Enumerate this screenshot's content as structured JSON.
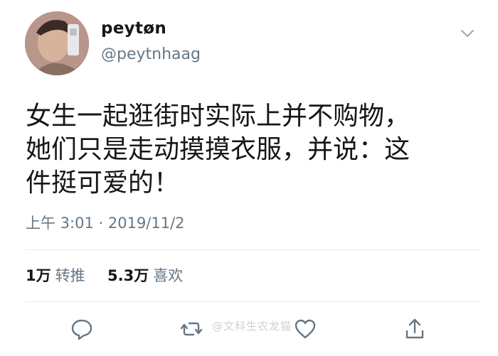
{
  "user": {
    "display_name": "peytøn",
    "handle": "@peytnhaag",
    "avatar_icon": "profile-photo"
  },
  "tweet": {
    "text": "女生一起逛街时实际上并不购物，\n她们只是走动摸摸衣服，并说：这\n件挺可爱的！",
    "timestamp": "上午 3:01 · 2019/11/2"
  },
  "stats": {
    "retweets_count": "1万",
    "retweets_label": "转推",
    "likes_count": "5.3万",
    "likes_label": "喜欢"
  },
  "actions": {
    "reply_icon": "reply-icon",
    "retweet_icon": "retweet-icon",
    "like_icon": "heart-icon",
    "share_icon": "share-icon"
  },
  "watermark": "@文科生农龙猫",
  "colors": {
    "text_primary": "#14171a",
    "text_secondary": "#657786",
    "divider": "#e6ecf0"
  }
}
